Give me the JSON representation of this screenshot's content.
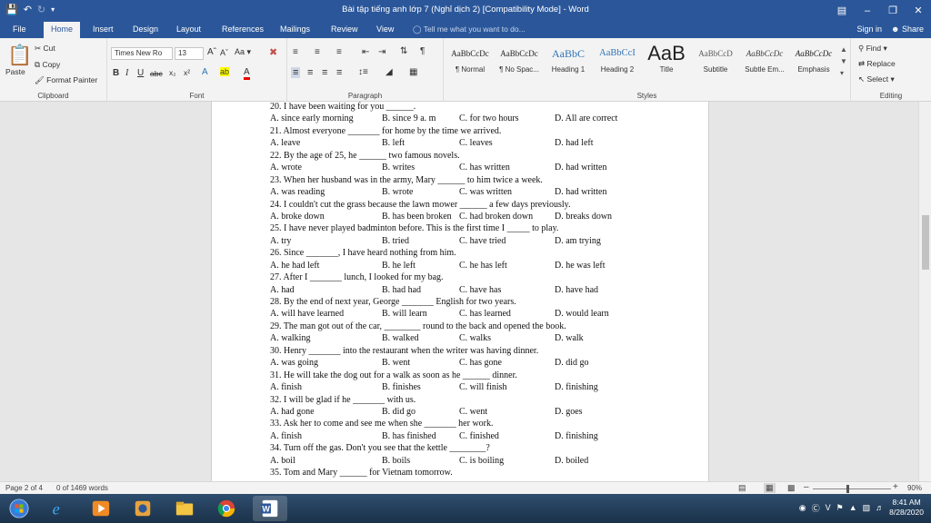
{
  "window": {
    "title": "Bài tập tiếng anh lớp 7 (Nghỉ dịch 2) [Compatibility Mode] - Word"
  },
  "tabs": [
    "File",
    "Home",
    "Insert",
    "Design",
    "Layout",
    "References",
    "Mailings",
    "Review",
    "View"
  ],
  "active_tab": "Home",
  "tell_me": "Tell me what you want to do...",
  "account": {
    "sign_in": "Sign in",
    "share": "Share"
  },
  "ribbon": {
    "clipboard": {
      "paste": "Paste",
      "cut": "Cut",
      "copy": "Copy",
      "format_painter": "Format Painter",
      "label": "Clipboard"
    },
    "font": {
      "family": "Times New Ro",
      "size": "13",
      "label": "Font"
    },
    "paragraph": {
      "label": "Paragraph"
    },
    "styles": {
      "label": "Styles",
      "items": [
        {
          "preview": "AaBbCcDc",
          "name": "¶ Normal"
        },
        {
          "preview": "AaBbCcDc",
          "name": "¶ No Spac..."
        },
        {
          "preview": "AaBbC",
          "name": "Heading 1"
        },
        {
          "preview": "AaBbCcI",
          "name": "Heading 2"
        },
        {
          "preview": "AaB",
          "name": "Title"
        },
        {
          "preview": "AaBbCcD",
          "name": "Subtitle"
        },
        {
          "preview": "AaBbCcDc",
          "name": "Subtle Em..."
        },
        {
          "preview": "AaBbCcDc",
          "name": "Emphasis"
        }
      ]
    },
    "editing": {
      "find": "Find",
      "replace": "Replace",
      "select": "Select",
      "label": "Editing"
    }
  },
  "document": {
    "lines": [
      {
        "q": "20. I have been waiting for you ______."
      },
      {
        "a": "A. since early morning",
        "b": "B. since 9 a. m",
        "c": "C. for two hours",
        "d": "D. All are correct"
      },
      {
        "q": "21. Almost everyone _______ for home by the time we arrived."
      },
      {
        "a": "A. leave",
        "b": "B. left",
        "c": "C. leaves",
        "d": "D. had left"
      },
      {
        "q": "22. By the age of 25, he ______ two famous novels."
      },
      {
        "a": "A. wrote",
        "b": "B. writes",
        "c": "C. has written",
        "d": "D. had written"
      },
      {
        "q": "23. When her husband was in the army, Mary ______ to him twice a week."
      },
      {
        "a": "A. was reading",
        "b": "B. wrote",
        "c": "C. was written",
        "d": "D. had written"
      },
      {
        "q": "24. I couldn't cut the grass because the lawn mower ______ a few days previously."
      },
      {
        "a": "A. broke down",
        "b": "B. has been broken",
        "c": "C. had broken down",
        "d": "D. breaks down"
      },
      {
        "q": "25. I have never played badminton before. This is the first time I _____ to play."
      },
      {
        "a": "A. try",
        "b": "B. tried",
        "c": "C. have tried",
        "d": "D. am trying"
      },
      {
        "q": "26. Since _______, I have heard nothing from him."
      },
      {
        "a": "A. he had left",
        "b": "B. he left",
        "c": "C. he has left",
        "d": "D. he was left"
      },
      {
        "q": "27. After I _______ lunch, I looked for my bag."
      },
      {
        "a": "A. had",
        "b": "B. had had",
        "c": "C. have has",
        "d": "D. have had"
      },
      {
        "q": "28. By the end of next year, George _______ English for two years."
      },
      {
        "a": "A. will have learned",
        "b": "B. will learn",
        "c": "C. has learned",
        "d": "D. would learn"
      },
      {
        "q": "29. The man got out of the car, ________ round to the back and opened the book."
      },
      {
        "a": "A. walking",
        "b": "B. walked",
        "c": "C. walks",
        "d": "D. walk"
      },
      {
        "q": "30. Henry _______ into the restaurant when the writer was having dinner."
      },
      {
        "a": "A. was going",
        "b": "B. went",
        "c": "C. has gone",
        "d": "D. did go"
      },
      {
        "q": "31. He will take the dog out for a walk as soon as he ______ dinner."
      },
      {
        "a": "A. finish",
        "b": "B. finishes",
        "c": "C. will finish",
        "d": "D. finishing"
      },
      {
        "q": "32. I will be glad if he _______ with us."
      },
      {
        "a": "A. had gone",
        "b": "B. did go",
        "c": "C. went",
        "d": "D. goes"
      },
      {
        "q": "33. Ask her to come and see me when she _______ her work."
      },
      {
        "a": "A. finish",
        "b": "B. has finished",
        "c": "C. finished",
        "d": "D. finishing"
      },
      {
        "q": "34. Turn off the gas. Don't you see that the kettle ________?"
      },
      {
        "a": "A. boil",
        "b": "B. boils",
        "c": "C. is boiling",
        "d": "D. boiled"
      },
      {
        "q": "35. Tom and Mary ______ for Vietnam tomorrow."
      }
    ]
  },
  "status": {
    "page": "Page 2 of 4",
    "words": "0 of 1469 words",
    "zoom": "90%",
    "zoom_level": 0.9
  },
  "taskbar": {
    "time": "8:41 AM",
    "date": "8/28/2020",
    "lang": "V"
  }
}
